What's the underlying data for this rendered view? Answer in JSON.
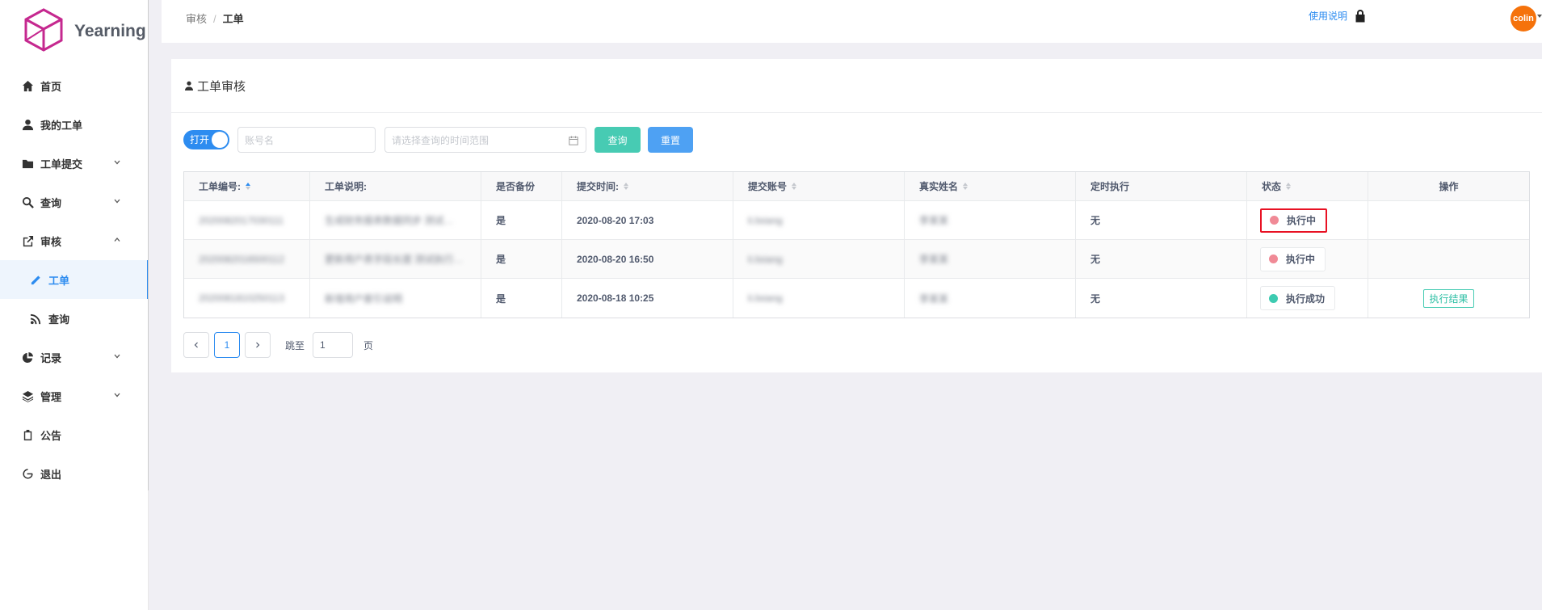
{
  "app": {
    "name": "Yearning"
  },
  "sidebar": {
    "items": [
      {
        "label": "首页",
        "icon": "home-icon"
      },
      {
        "label": "我的工单",
        "icon": "user-icon"
      },
      {
        "label": "工单提交",
        "icon": "folder-icon"
      },
      {
        "label": "查询",
        "icon": "search-icon"
      },
      {
        "label": "审核",
        "icon": "edit-icon"
      },
      {
        "label": "工单",
        "icon": "pencil-icon"
      },
      {
        "label": "查询",
        "icon": "rss-icon"
      },
      {
        "label": "记录",
        "icon": "pie-chart-icon"
      },
      {
        "label": "管理",
        "icon": "layers-icon"
      },
      {
        "label": "公告",
        "icon": "clipboard-icon"
      },
      {
        "label": "退出",
        "icon": "logout-icon"
      }
    ]
  },
  "header": {
    "breadcrumb": [
      "审核",
      "工单"
    ],
    "help_link": "使用说明",
    "user": "colin"
  },
  "card": {
    "title": "工单审核",
    "filters": {
      "switch_label": "打开",
      "account_placeholder": "账号名",
      "date_placeholder": "请选择查询的时间范围",
      "query_button": "查询",
      "reset_button": "重置"
    },
    "table": {
      "columns": [
        "工单编号:",
        "工单说明:",
        "是否备份",
        "提交时间:",
        "提交账号",
        "真实姓名",
        "定时执行",
        "状态",
        "操作"
      ],
      "rows": [
        {
          "id": "2020082017030111",
          "desc": "生成财务报表数据同步 测试…",
          "backup": "是",
          "time": "2020-08-20 17:03",
          "account": "li.lixiang",
          "realname": "李某某",
          "scheduled": "无",
          "status": "执行中",
          "status_color": "#f08a96",
          "action": ""
        },
        {
          "id": "2020082016500112",
          "desc": "更新用户表字段长度 测试执行…",
          "backup": "是",
          "time": "2020-08-20 16:50",
          "account": "li.lixiang",
          "realname": "李某某",
          "scheduled": "无",
          "status": "执行中",
          "status_color": "#f08a96",
          "action": ""
        },
        {
          "id": "2020081810250113",
          "desc": "新增用户索引说明",
          "backup": "是",
          "time": "2020-08-18 10:25",
          "account": "li.lixiang",
          "realname": "李某某",
          "scheduled": "无",
          "status": "执行成功",
          "status_color": "#3dcbb1",
          "action": "执行结果"
        }
      ]
    },
    "pager": {
      "current_page": "1",
      "jump_label": "跳至",
      "jump_value": "1",
      "page_label": "页"
    }
  }
}
